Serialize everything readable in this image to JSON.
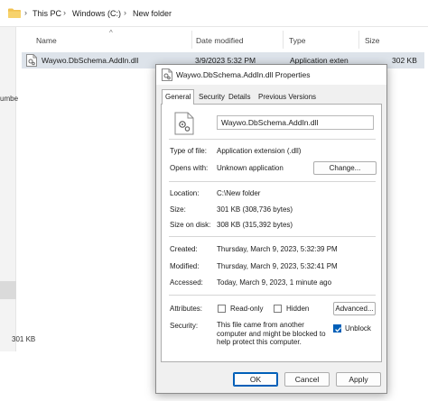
{
  "explorer": {
    "breadcrumb": [
      "This PC",
      "Windows (C:)",
      "New folder"
    ],
    "left_pane_peek": "umbe",
    "columns": [
      "Name",
      "Date modified",
      "Type",
      "Size"
    ],
    "row": {
      "name": "Waywo.DbSchema.AddIn.dll",
      "date": "3/9/2023 5:32 PM",
      "type": "Application exten",
      "size": "302 KB"
    },
    "status_size": "301 KB"
  },
  "dialog": {
    "title": "Waywo.DbSchema.AddIn.dll Properties",
    "tabs": [
      "General",
      "Security",
      "Details",
      "Previous Versions"
    ],
    "active_tab": "General",
    "file_name": "Waywo.DbSchema.AddIn.dll",
    "type_label": "Type of file:",
    "type_value": "Application extension (.dll)",
    "opens_label": "Opens with:",
    "opens_value": "Unknown application",
    "change_button": "Change...",
    "location_label": "Location:",
    "location_value": "C:\\New folder",
    "size_label": "Size:",
    "size_value": "301 KB (308,736 bytes)",
    "size_on_disk_label": "Size on disk:",
    "size_on_disk_value": "308 KB (315,392 bytes)",
    "created_label": "Created:",
    "created_value": "Thursday, March 9, 2023, 5:32:39 PM",
    "modified_label": "Modified:",
    "modified_value": "Thursday, March 9, 2023, 5:32:41 PM",
    "accessed_label": "Accessed:",
    "accessed_value": "Today, March 9, 2023, 1 minute ago",
    "attributes_label": "Attributes:",
    "readonly_label": "Read-only",
    "readonly_checked": false,
    "hidden_label": "Hidden",
    "hidden_checked": false,
    "advanced_button": "Advanced...",
    "security_label": "Security:",
    "security_text": "This file came from another computer and might be blocked to help protect this computer.",
    "unblock_label": "Unblock",
    "unblock_checked": true,
    "ok_button": "OK",
    "cancel_button": "Cancel",
    "apply_button": "Apply"
  },
  "icons": {
    "folder": "folder-icon",
    "file": "dll-file-icon",
    "checkmark": "check-icon"
  },
  "colors": {
    "accent": "#005fb8",
    "row_selected": "#dde3ea",
    "folder_yellow": "#f2c14e"
  }
}
